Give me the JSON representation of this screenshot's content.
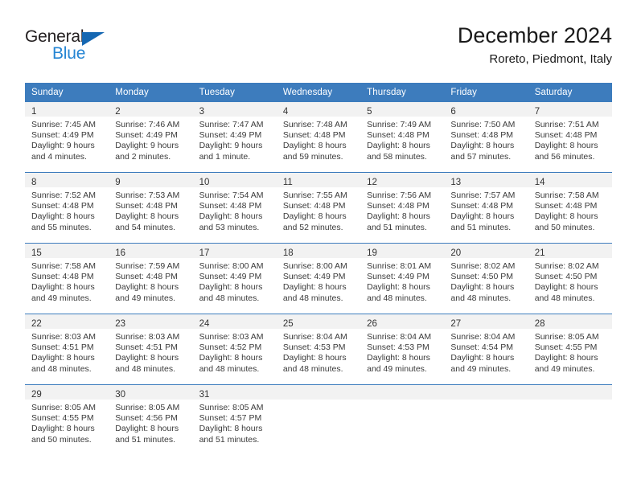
{
  "brand": {
    "name_part1": "General",
    "name_part2": "Blue",
    "triangle_color": "#1567b2",
    "blue_color": "#2585d3"
  },
  "header": {
    "title": "December 2024",
    "subtitle": "Roreto, Piedmont, Italy"
  },
  "theme": {
    "header_bg": "#3d7cbd",
    "header_text": "#ffffff",
    "daynum_band_bg": "#f2f2f2",
    "cell_border": "#3d7cbd"
  },
  "weekdays": [
    "Sunday",
    "Monday",
    "Tuesday",
    "Wednesday",
    "Thursday",
    "Friday",
    "Saturday"
  ],
  "weeks": [
    [
      {
        "day": "1",
        "sunrise": "Sunrise: 7:45 AM",
        "sunset": "Sunset: 4:49 PM",
        "daylight1": "Daylight: 9 hours",
        "daylight2": "and 4 minutes."
      },
      {
        "day": "2",
        "sunrise": "Sunrise: 7:46 AM",
        "sunset": "Sunset: 4:49 PM",
        "daylight1": "Daylight: 9 hours",
        "daylight2": "and 2 minutes."
      },
      {
        "day": "3",
        "sunrise": "Sunrise: 7:47 AM",
        "sunset": "Sunset: 4:49 PM",
        "daylight1": "Daylight: 9 hours",
        "daylight2": "and 1 minute."
      },
      {
        "day": "4",
        "sunrise": "Sunrise: 7:48 AM",
        "sunset": "Sunset: 4:48 PM",
        "daylight1": "Daylight: 8 hours",
        "daylight2": "and 59 minutes."
      },
      {
        "day": "5",
        "sunrise": "Sunrise: 7:49 AM",
        "sunset": "Sunset: 4:48 PM",
        "daylight1": "Daylight: 8 hours",
        "daylight2": "and 58 minutes."
      },
      {
        "day": "6",
        "sunrise": "Sunrise: 7:50 AM",
        "sunset": "Sunset: 4:48 PM",
        "daylight1": "Daylight: 8 hours",
        "daylight2": "and 57 minutes."
      },
      {
        "day": "7",
        "sunrise": "Sunrise: 7:51 AM",
        "sunset": "Sunset: 4:48 PM",
        "daylight1": "Daylight: 8 hours",
        "daylight2": "and 56 minutes."
      }
    ],
    [
      {
        "day": "8",
        "sunrise": "Sunrise: 7:52 AM",
        "sunset": "Sunset: 4:48 PM",
        "daylight1": "Daylight: 8 hours",
        "daylight2": "and 55 minutes."
      },
      {
        "day": "9",
        "sunrise": "Sunrise: 7:53 AM",
        "sunset": "Sunset: 4:48 PM",
        "daylight1": "Daylight: 8 hours",
        "daylight2": "and 54 minutes."
      },
      {
        "day": "10",
        "sunrise": "Sunrise: 7:54 AM",
        "sunset": "Sunset: 4:48 PM",
        "daylight1": "Daylight: 8 hours",
        "daylight2": "and 53 minutes."
      },
      {
        "day": "11",
        "sunrise": "Sunrise: 7:55 AM",
        "sunset": "Sunset: 4:48 PM",
        "daylight1": "Daylight: 8 hours",
        "daylight2": "and 52 minutes."
      },
      {
        "day": "12",
        "sunrise": "Sunrise: 7:56 AM",
        "sunset": "Sunset: 4:48 PM",
        "daylight1": "Daylight: 8 hours",
        "daylight2": "and 51 minutes."
      },
      {
        "day": "13",
        "sunrise": "Sunrise: 7:57 AM",
        "sunset": "Sunset: 4:48 PM",
        "daylight1": "Daylight: 8 hours",
        "daylight2": "and 51 minutes."
      },
      {
        "day": "14",
        "sunrise": "Sunrise: 7:58 AM",
        "sunset": "Sunset: 4:48 PM",
        "daylight1": "Daylight: 8 hours",
        "daylight2": "and 50 minutes."
      }
    ],
    [
      {
        "day": "15",
        "sunrise": "Sunrise: 7:58 AM",
        "sunset": "Sunset: 4:48 PM",
        "daylight1": "Daylight: 8 hours",
        "daylight2": "and 49 minutes."
      },
      {
        "day": "16",
        "sunrise": "Sunrise: 7:59 AM",
        "sunset": "Sunset: 4:48 PM",
        "daylight1": "Daylight: 8 hours",
        "daylight2": "and 49 minutes."
      },
      {
        "day": "17",
        "sunrise": "Sunrise: 8:00 AM",
        "sunset": "Sunset: 4:49 PM",
        "daylight1": "Daylight: 8 hours",
        "daylight2": "and 48 minutes."
      },
      {
        "day": "18",
        "sunrise": "Sunrise: 8:00 AM",
        "sunset": "Sunset: 4:49 PM",
        "daylight1": "Daylight: 8 hours",
        "daylight2": "and 48 minutes."
      },
      {
        "day": "19",
        "sunrise": "Sunrise: 8:01 AM",
        "sunset": "Sunset: 4:49 PM",
        "daylight1": "Daylight: 8 hours",
        "daylight2": "and 48 minutes."
      },
      {
        "day": "20",
        "sunrise": "Sunrise: 8:02 AM",
        "sunset": "Sunset: 4:50 PM",
        "daylight1": "Daylight: 8 hours",
        "daylight2": "and 48 minutes."
      },
      {
        "day": "21",
        "sunrise": "Sunrise: 8:02 AM",
        "sunset": "Sunset: 4:50 PM",
        "daylight1": "Daylight: 8 hours",
        "daylight2": "and 48 minutes."
      }
    ],
    [
      {
        "day": "22",
        "sunrise": "Sunrise: 8:03 AM",
        "sunset": "Sunset: 4:51 PM",
        "daylight1": "Daylight: 8 hours",
        "daylight2": "and 48 minutes."
      },
      {
        "day": "23",
        "sunrise": "Sunrise: 8:03 AM",
        "sunset": "Sunset: 4:51 PM",
        "daylight1": "Daylight: 8 hours",
        "daylight2": "and 48 minutes."
      },
      {
        "day": "24",
        "sunrise": "Sunrise: 8:03 AM",
        "sunset": "Sunset: 4:52 PM",
        "daylight1": "Daylight: 8 hours",
        "daylight2": "and 48 minutes."
      },
      {
        "day": "25",
        "sunrise": "Sunrise: 8:04 AM",
        "sunset": "Sunset: 4:53 PM",
        "daylight1": "Daylight: 8 hours",
        "daylight2": "and 48 minutes."
      },
      {
        "day": "26",
        "sunrise": "Sunrise: 8:04 AM",
        "sunset": "Sunset: 4:53 PM",
        "daylight1": "Daylight: 8 hours",
        "daylight2": "and 49 minutes."
      },
      {
        "day": "27",
        "sunrise": "Sunrise: 8:04 AM",
        "sunset": "Sunset: 4:54 PM",
        "daylight1": "Daylight: 8 hours",
        "daylight2": "and 49 minutes."
      },
      {
        "day": "28",
        "sunrise": "Sunrise: 8:05 AM",
        "sunset": "Sunset: 4:55 PM",
        "daylight1": "Daylight: 8 hours",
        "daylight2": "and 49 minutes."
      }
    ],
    [
      {
        "day": "29",
        "sunrise": "Sunrise: 8:05 AM",
        "sunset": "Sunset: 4:55 PM",
        "daylight1": "Daylight: 8 hours",
        "daylight2": "and 50 minutes."
      },
      {
        "day": "30",
        "sunrise": "Sunrise: 8:05 AM",
        "sunset": "Sunset: 4:56 PM",
        "daylight1": "Daylight: 8 hours",
        "daylight2": "and 51 minutes."
      },
      {
        "day": "31",
        "sunrise": "Sunrise: 8:05 AM",
        "sunset": "Sunset: 4:57 PM",
        "daylight1": "Daylight: 8 hours",
        "daylight2": "and 51 minutes."
      },
      {
        "day": "",
        "sunrise": "",
        "sunset": "",
        "daylight1": "",
        "daylight2": ""
      },
      {
        "day": "",
        "sunrise": "",
        "sunset": "",
        "daylight1": "",
        "daylight2": ""
      },
      {
        "day": "",
        "sunrise": "",
        "sunset": "",
        "daylight1": "",
        "daylight2": ""
      },
      {
        "day": "",
        "sunrise": "",
        "sunset": "",
        "daylight1": "",
        "daylight2": ""
      }
    ]
  ]
}
